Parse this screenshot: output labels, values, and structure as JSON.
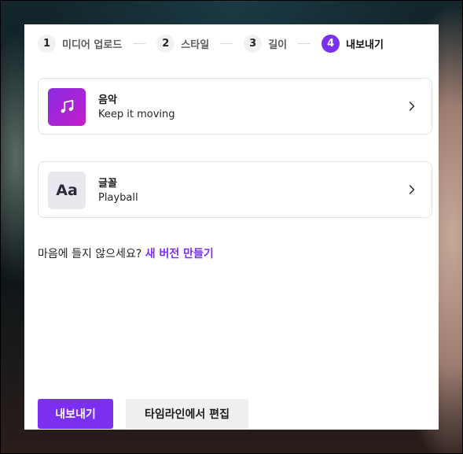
{
  "stepper": {
    "steps": [
      {
        "number": "1",
        "label": "미디어 업로드"
      },
      {
        "number": "2",
        "label": "스타일"
      },
      {
        "number": "3",
        "label": "길이"
      },
      {
        "number": "4",
        "label": "내보내기"
      }
    ],
    "active_step": 4
  },
  "music_card": {
    "title": "음악",
    "subtitle": "Keep it moving",
    "icon": "music-note-icon"
  },
  "font_card": {
    "title": "글꼴",
    "subtitle": "Playball",
    "thumb_text": "Aa"
  },
  "retry": {
    "prompt": "마음에 들지 않으세요?",
    "link": "새 버전 만들기"
  },
  "actions": {
    "export_label": "내보내기",
    "timeline_label": "타임라인에서 편집"
  },
  "colors": {
    "accent": "#7b2ff0",
    "music_gradient_start": "#8a2be2",
    "music_gradient_end": "#c21fc9"
  }
}
